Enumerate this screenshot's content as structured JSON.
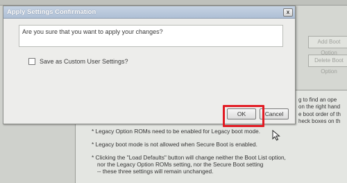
{
  "dialog": {
    "title": "Apply Settings Confirmation",
    "message": "Are you sure that you want to apply your changes?",
    "checkbox_label": "Save as Custom User Settings?",
    "checkbox_checked": false,
    "ok_label": "OK",
    "cancel_label": "Cancel",
    "close_glyph": "x"
  },
  "background": {
    "buttons": [
      "Add Boot Option",
      "Delete Boot Option"
    ],
    "side_fragments": [
      "g to find an ope",
      "on the right hand",
      "e boot order of th",
      "heck boxes on th"
    ],
    "notes": [
      "* Legacy Option ROMs need to be enabled for Legacy boot mode.",
      "* Legacy boot mode is not allowed when Secure Boot is enabled.",
      "* Clicking the \"Load Defaults\" button will change neither the Boot List option,",
      "nor the Legacy Option ROMs setting, nor the Secure Boot setting",
      "-- these three settings will remain unchanged."
    ]
  },
  "colors": {
    "highlight": "#e21a22",
    "titlebar": "#aebfd5",
    "background": "#cfd1cc"
  }
}
